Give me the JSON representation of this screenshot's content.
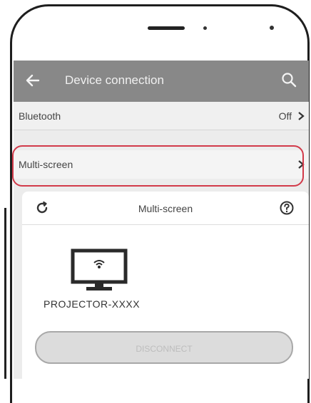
{
  "appbar": {
    "title": "Device connection"
  },
  "settings": {
    "bluetooth": {
      "label": "Bluetooth",
      "value": "Off"
    },
    "multiscreen": {
      "label": "Multi-screen"
    }
  },
  "panel": {
    "title": "Multi-screen",
    "device_name": "PROJECTOR-XXXX",
    "disconnect_label": "DISCONNECT"
  },
  "colors": {
    "appbar_bg": "#888888",
    "highlight": "#d23a4a",
    "screen_bg": "#ececec"
  },
  "icons": [
    "back-arrow-icon",
    "search-icon",
    "chevron-right-icon",
    "refresh-icon",
    "help-icon",
    "monitor-icon"
  ]
}
